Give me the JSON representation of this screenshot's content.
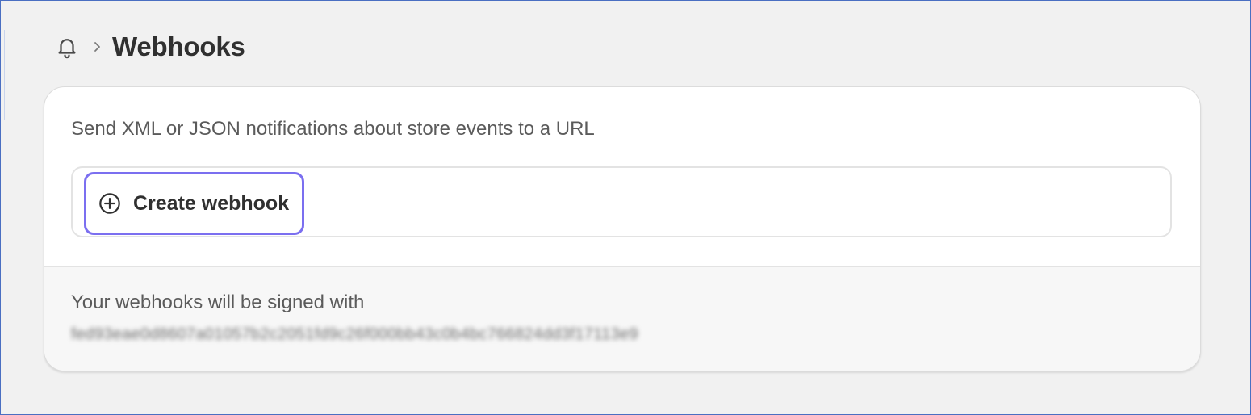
{
  "header": {
    "bell_icon": "bell-icon",
    "separator_icon": "chevron-right-icon",
    "title": "Webhooks"
  },
  "card": {
    "description": "Send XML or JSON notifications about store events to a URL",
    "create_button": {
      "icon": "plus-circle-icon",
      "label": "Create webhook"
    },
    "signing": {
      "label": "Your webhooks will be signed with",
      "secret": "fed93eae0d8607a01057b2c2051fd9c26f000bb43c0b4bc766824dd3f17113e9"
    }
  },
  "colors": {
    "focus_ring": "#7b6ff0",
    "text_primary": "#303030",
    "text_secondary": "#5b5b5b",
    "page_background": "#f1f1f1"
  }
}
